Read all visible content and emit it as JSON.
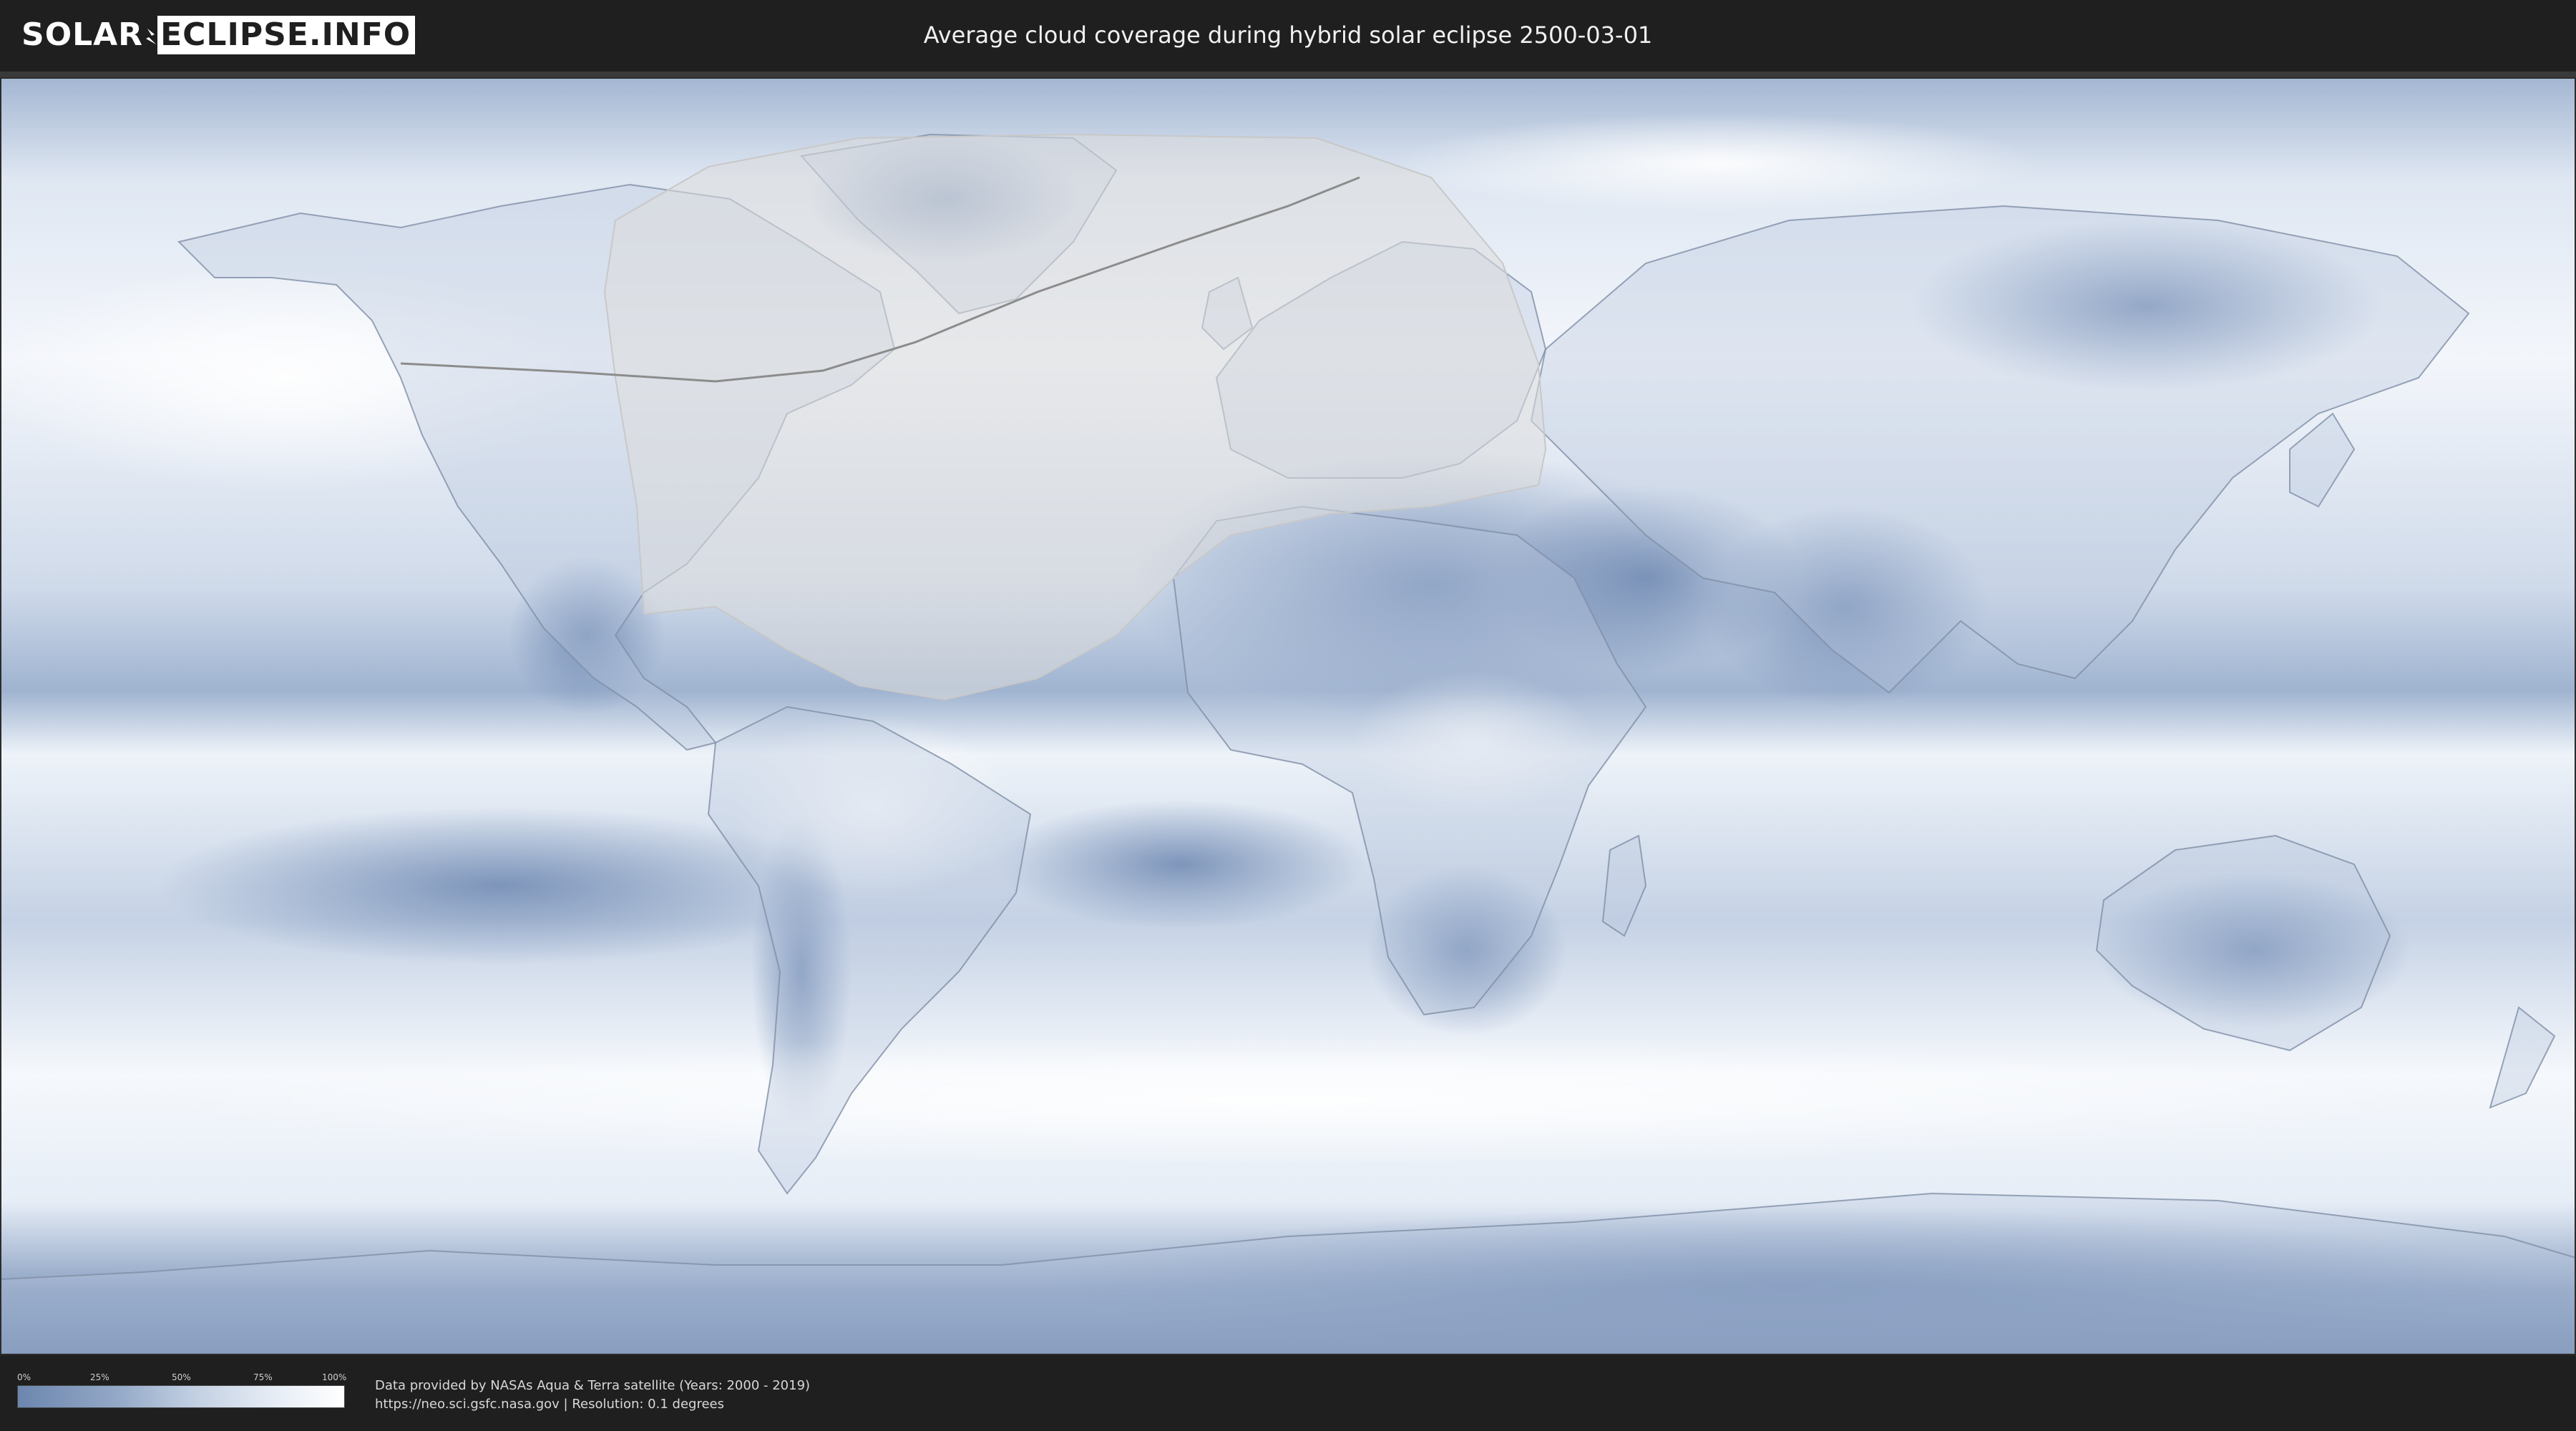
{
  "header": {
    "logo_left": "SOLAR",
    "logo_right": "ECLIPSE.INFO",
    "title": "Average cloud coverage during hybrid solar eclipse 2500-03-01"
  },
  "map": {
    "projection": "equirectangular world map",
    "layers": [
      "cloud-coverage",
      "country-borders",
      "eclipse-visibility-region",
      "eclipse-path"
    ],
    "colors": {
      "ocean_cloudy": "#e9eff7",
      "clear_sky": "#6f89b2",
      "mid_cover": "#a9bbd6",
      "eclipse_region": "#dcdcdc",
      "eclipse_path": "#8c8c8c",
      "borders": "#7f8fa6"
    }
  },
  "legend": {
    "ticks": [
      "0%",
      "25%",
      "50%",
      "75%",
      "100%"
    ],
    "gradient_start": "#6c86ae",
    "gradient_end": "#ffffff"
  },
  "footer": {
    "line1": "Data provided by NASAs Aqua & Terra satellite (Years: 2000 - 2019)",
    "line2": "https://neo.sci.gsfc.nasa.gov | Resolution: 0.1 degrees"
  }
}
